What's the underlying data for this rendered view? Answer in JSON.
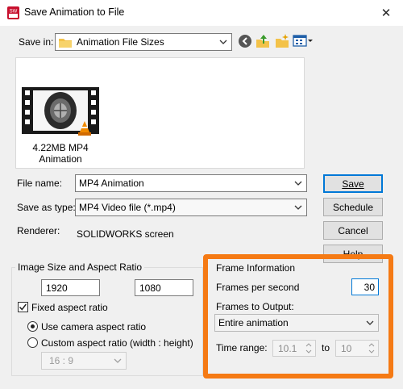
{
  "window": {
    "title": "Save Animation to File",
    "close_glyph": "✕"
  },
  "save_in": {
    "label": "Save in:",
    "value": "Animation File Sizes"
  },
  "preview_file": {
    "size_label": "4.22MB MP4",
    "name": "Animation"
  },
  "file_name": {
    "label": "File name:",
    "value": "MP4 Animation"
  },
  "save_as_type": {
    "label": "Save as type:",
    "value": "MP4 Video file (*.mp4)"
  },
  "renderer": {
    "label": "Renderer:",
    "value": "SOLIDWORKS screen"
  },
  "buttons": {
    "save": "Save",
    "schedule": "Schedule",
    "cancel": "Cancel",
    "help": "Help"
  },
  "image_size": {
    "title": "Image Size and Aspect Ratio",
    "width": "1920",
    "height": "1080",
    "fixed_aspect_label": "Fixed aspect ratio",
    "fixed_aspect_checked": true,
    "use_camera_label": "Use camera aspect ratio",
    "custom_label": "Custom aspect ratio (width : height)",
    "ratio_value": "16 : 9"
  },
  "frame_info": {
    "title": "Frame Information",
    "fps_label": "Frames per second",
    "fps_value": "30",
    "frames_output_label": "Frames to Output:",
    "frames_output_value": "Entire animation",
    "time_range_label": "Time range:",
    "time_from": "10.1",
    "to_label": "to",
    "time_to": "10"
  },
  "colors": {
    "highlight": "#f57a14",
    "accent": "#0078d7"
  },
  "icons": [
    "app-icon",
    "folder-icon",
    "back-icon",
    "up-folder-icon",
    "new-folder-icon",
    "view-menu-icon",
    "close-icon"
  ]
}
